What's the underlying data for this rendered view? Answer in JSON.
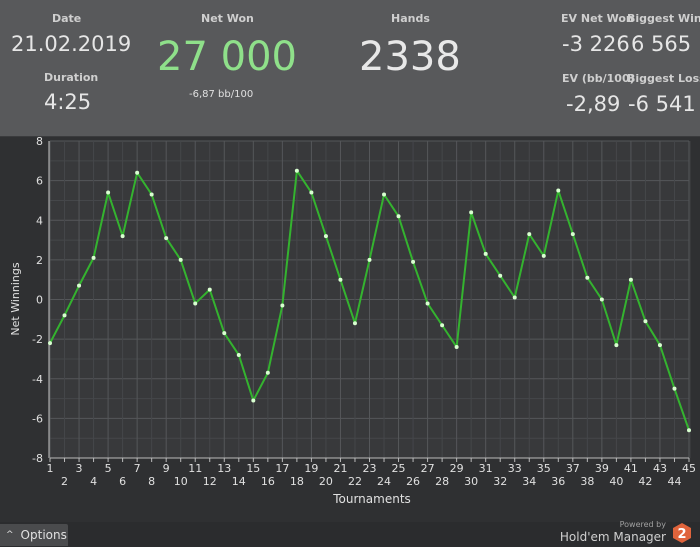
{
  "header": {
    "date_label": "Date",
    "date_value": "21.02.2019",
    "duration_label": "Duration",
    "duration_value": "4:25",
    "netwon_label": "Net Won",
    "netwon_value": "27 000",
    "netwon_sub": "-6,87 bb/100",
    "hands_label": "Hands",
    "hands_value": "2338",
    "ev_net_won_label": "EV Net Won",
    "ev_net_won_value": "-3 226",
    "biggest_win_label": "Biggest Win",
    "biggest_win_value": "6 565",
    "ev_bb_label": "EV (bb/100)",
    "ev_bb_value": "-2,89",
    "biggest_loss_label": "Biggest Loss",
    "biggest_loss_value": "-6 541"
  },
  "colors": {
    "netwon_value": "#8fe08a",
    "line": "#34b32f",
    "point": "#d8ffd0",
    "logo": "#e0643c"
  },
  "chart_data": {
    "type": "line",
    "xlabel": "Tournaments",
    "ylabel": "Net Winnings",
    "ylim": [
      -8,
      8
    ],
    "xlim": [
      1,
      45
    ],
    "yticks": [
      -8,
      -6,
      -4,
      -2,
      0,
      2,
      4,
      6,
      8
    ],
    "grid": true,
    "x": [
      1,
      2,
      3,
      4,
      5,
      6,
      7,
      8,
      9,
      10,
      11,
      12,
      13,
      14,
      15,
      16,
      17,
      18,
      19,
      20,
      21,
      22,
      23,
      24,
      25,
      26,
      27,
      28,
      29,
      30,
      31,
      32,
      33,
      34,
      35,
      36,
      37,
      38,
      39,
      40,
      41,
      42,
      43,
      44,
      45
    ],
    "series": [
      {
        "values": [
          -2.2,
          -0.8,
          0.7,
          2.1,
          5.4,
          3.2,
          6.4,
          5.3,
          3.1,
          2.0,
          -0.2,
          0.5,
          -1.7,
          -2.8,
          -5.1,
          -3.7,
          -0.3,
          6.5,
          5.4,
          3.2,
          1.0,
          -1.2,
          2.0,
          5.3,
          4.2,
          1.9,
          -0.2,
          -1.3,
          -2.4,
          4.4,
          2.3,
          1.2,
          0.1,
          3.3,
          2.2,
          5.5,
          3.3,
          1.1,
          0.0,
          -2.3,
          1.0,
          -1.1,
          -2.3,
          -4.5,
          -6.6
        ]
      }
    ]
  },
  "footer": {
    "options_label": "Options",
    "options_caret": "^",
    "powered_by": "Powered by",
    "product_name": "Hold'em Manager",
    "logo_digit": "2"
  }
}
